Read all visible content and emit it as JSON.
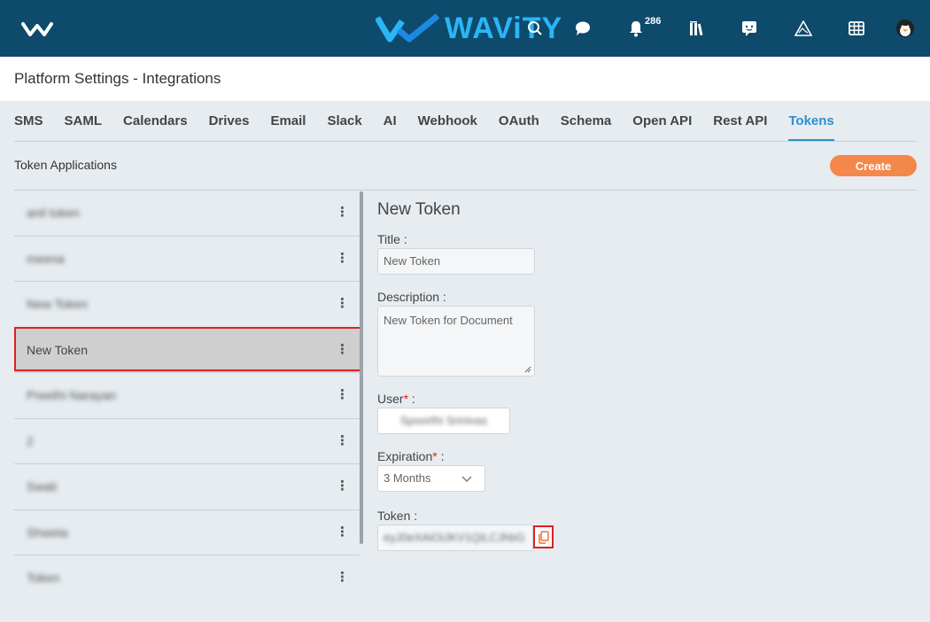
{
  "topbar": {
    "brand": "WAViTY",
    "notification_count": "286",
    "icons": [
      "menu-logo-icon",
      "search-icon",
      "chat-icon",
      "bell-icon",
      "library-icon",
      "feedback-icon",
      "triangle-icon",
      "grid-icon",
      "avatar"
    ]
  },
  "page": {
    "title": "Platform Settings - Integrations"
  },
  "tabs": [
    {
      "label": "SMS"
    },
    {
      "label": "SAML"
    },
    {
      "label": "Calendars"
    },
    {
      "label": "Drives"
    },
    {
      "label": "Email"
    },
    {
      "label": "Slack"
    },
    {
      "label": "AI"
    },
    {
      "label": "Webhook"
    },
    {
      "label": "OAuth"
    },
    {
      "label": "Schema"
    },
    {
      "label": "Open API"
    },
    {
      "label": "Rest API"
    },
    {
      "label": "Tokens",
      "active": true
    }
  ],
  "section": {
    "title": "Token Applications",
    "create_label": "Create"
  },
  "tokens": [
    {
      "name": "anil token",
      "blurred": true
    },
    {
      "name": "meena",
      "blurred": true
    },
    {
      "name": "New Token",
      "blurred": true
    },
    {
      "name": "New Token",
      "blurred": false,
      "selected": true
    },
    {
      "name": "Preethi Narayan",
      "blurred": true
    },
    {
      "name": "2",
      "blurred": true
    },
    {
      "name": "Swati",
      "blurred": true
    },
    {
      "name": "Shweta",
      "blurred": true
    },
    {
      "name": "Token",
      "blurred": true
    }
  ],
  "form": {
    "heading": "New Token",
    "title_label": "Title",
    "title_value": "New Token",
    "description_label": "Description",
    "description_value": "New Token for Document",
    "user_label": "User",
    "user_value": "Spoorthi Srinivas",
    "expiration_label": "Expiration",
    "expiration_value": "3 Months",
    "token_label": "Token",
    "token_value": "eyJ0eXAiOiJKV1QiLCJhbG"
  },
  "colors": {
    "topbar": "#0d4a6b",
    "accent": "#2e8fcf",
    "create": "#f4874a",
    "highlight": "#e02020"
  }
}
